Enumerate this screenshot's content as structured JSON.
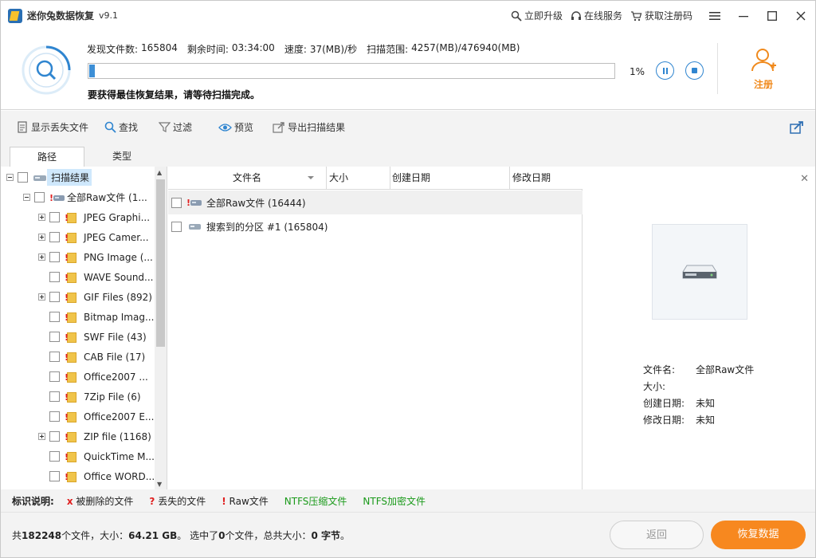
{
  "app": {
    "title": "迷你兔数据恢复",
    "version": "v9.1",
    "links": {
      "upgrade": "立即升级",
      "online": "在线服务",
      "regcode": "获取注册码"
    }
  },
  "scan": {
    "found_label": "发现文件数:",
    "found": "165804",
    "remain_label": "剩余时间:",
    "remain": "03:34:00",
    "speed_label": "速度:",
    "speed": "37(MB)/秒",
    "range_label": "扫描范围:",
    "range": "4257(MB)/476940(MB)",
    "progress_pct": "1%",
    "progress_fraction": 0.011,
    "hint": "要获得最佳恢复结果，请等待扫描完成。",
    "register": "注册",
    "accent": "#2f85d0"
  },
  "toolbar": {
    "show_lost": "显示丢失文件",
    "find": "查找",
    "filter": "过滤",
    "preview": "预览",
    "export": "导出扫描结果"
  },
  "tabs": {
    "path": "路径",
    "type": "类型"
  },
  "tree": {
    "root": "扫描结果",
    "raw": "全部Raw文件 (1...",
    "items": [
      {
        "label": "JPEG Graphi...",
        "expandable": true
      },
      {
        "label": "JPEG Camer...",
        "expandable": true
      },
      {
        "label": "PNG Image (...",
        "expandable": true
      },
      {
        "label": "WAVE Sound...",
        "expandable": false
      },
      {
        "label": "GIF Files (892)",
        "expandable": true
      },
      {
        "label": "Bitmap Imag...",
        "expandable": false
      },
      {
        "label": "SWF File (43)",
        "expandable": false
      },
      {
        "label": "CAB File (17)",
        "expandable": false
      },
      {
        "label": "Office2007 ...",
        "expandable": false
      },
      {
        "label": "7Zip File (6)",
        "expandable": false
      },
      {
        "label": "Office2007 E...",
        "expandable": false
      },
      {
        "label": "ZIP file (1168)",
        "expandable": true
      },
      {
        "label": "QuickTime M...",
        "expandable": false
      },
      {
        "label": "Office WORD...",
        "expandable": false
      }
    ]
  },
  "filelist": {
    "columns": {
      "name": "文件名",
      "size": "大小",
      "created": "创建日期",
      "modified": "修改日期"
    },
    "rows": [
      {
        "name": "全部Raw文件 (16444)"
      },
      {
        "name": "搜索到的分区 #1 (165804)"
      }
    ]
  },
  "preview": {
    "name_label": "文件名:",
    "name": "全部Raw文件",
    "size_label": "大小:",
    "size": "",
    "created_label": "创建日期:",
    "created": "未知",
    "modified_label": "修改日期:",
    "modified": "未知"
  },
  "legend": {
    "title": "标识说明:",
    "deleted_mark": "x",
    "deleted": "被删除的文件",
    "lost_mark": "?",
    "lost": "丢失的文件",
    "raw_mark": "!",
    "raw": "Raw文件",
    "ntfs_comp": "NTFS压缩文件",
    "ntfs_enc": "NTFS加密文件"
  },
  "status": {
    "p1": "共",
    "files": "182248",
    "p2": "个文件，大小：",
    "size": "64.21 GB",
    "p3": "。 选中了",
    "sel": "0",
    "p4": "个文件，总共大小：",
    "selsize": "0 字节",
    "p5": "。"
  },
  "buttons": {
    "back": "返回",
    "recover": "恢复数据"
  }
}
